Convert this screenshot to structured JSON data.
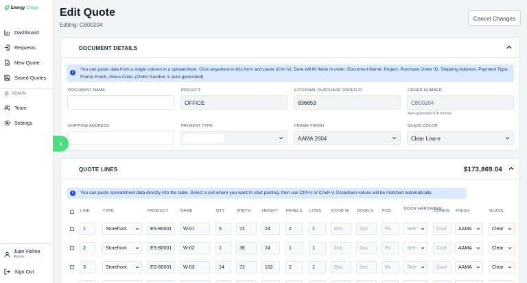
{
  "brand": {
    "name1": "Energy",
    "name2": "Check"
  },
  "nav": {
    "dashboard": "Dashboard",
    "requests": "Requests",
    "new_quote": "New Quote",
    "saved_quotes": "Saved Quotes",
    "admin_section": "ADMIN",
    "team": "Team",
    "settings": "Settings"
  },
  "user": {
    "name": "Juan Vielma",
    "role": "Admin",
    "sign_out": "Sign Out"
  },
  "page": {
    "title": "Edit Quote",
    "subtitle": "Editing: CB00204",
    "cancel": "Cancel Changes"
  },
  "doc": {
    "title": "DOCUMENT DETAILS",
    "info": "You can paste data from a single column in a spreadsheet. Click anywhere in this form and paste (Ctrl+V). Data will fill fields in order: Document Name, Project, Purchase Order ID, Shipping Address, Payment Type, Frame Finish, Glass Color. (Order Number is auto-generated)",
    "labels": {
      "document_name": "DOCUMENT NAME",
      "project": "PROJECT",
      "external_po": "EXTERNAL PURCHASE ORDER ID",
      "order_number": "ORDER NUMBER",
      "shipping": "SHIPPING ADDRESS",
      "payment": "PAYMENT TYPE",
      "frame": "FRAME FINISH",
      "glass": "GLASS COLOR"
    },
    "values": {
      "document_name": "",
      "project": "OFFICE",
      "external_po": "836653",
      "order_number": "CB00204",
      "shipping": "",
      "payment": "",
      "frame": "AAMA 2604",
      "glass": "Clear Low-e"
    },
    "order_hint": "Auto-generated (CB format)"
  },
  "lines": {
    "title": "QUOTE LINES",
    "total": "$173,869.04",
    "info": "You can paste spreadsheet data directly into the table. Select a cell where you want to start pasting, then use Ctrl+V or Cmd+V. Dropdown values will be matched automatically.",
    "headers": [
      "LINE",
      "TYPE",
      "PRODUCT",
      "NAME",
      "QTY",
      "WIDTH",
      "HEIGHT",
      "PANELS",
      "LITES",
      "DOOR W",
      "DOOR H",
      "POS",
      "DOOR HARDWARE",
      "CONFIG",
      "FINISH",
      "GLASS"
    ],
    "placeholders": {
      "door_w": "Doc",
      "door_h": "Doc",
      "pos": "Po",
      "hardware": "Sele",
      "config": "Conf"
    },
    "rows": [
      {
        "line": "1",
        "type": "Storefront",
        "product": "ES-80001",
        "name": "W-01",
        "qty": "5",
        "width": "72",
        "height": "24",
        "panels": "2",
        "lites": "1",
        "finish": "AAMA",
        "glass": "Clear"
      },
      {
        "line": "2",
        "type": "Storefront",
        "product": "ES-80001",
        "name": "W-02",
        "qty": "1",
        "width": "36",
        "height": "24",
        "panels": "1",
        "lites": "1",
        "finish": "AAMA",
        "glass": "Clear"
      },
      {
        "line": "3",
        "type": "Storefront",
        "product": "ES-80001",
        "name": "W-03",
        "qty": "14",
        "width": "72",
        "height": "102",
        "panels": "2",
        "lites": "1",
        "finish": "AAMA",
        "glass": "Clear"
      }
    ]
  },
  "colors": {
    "accent": "#4ade80",
    "info_bg": "#dbeafe",
    "info_text": "#1e3a8a"
  }
}
